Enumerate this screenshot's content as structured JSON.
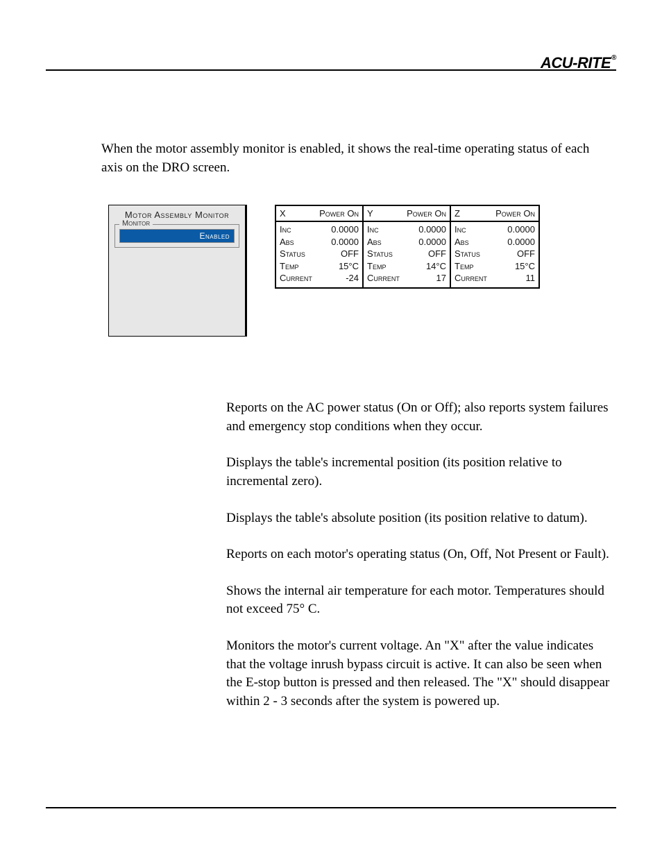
{
  "brand": "ACU-RITE",
  "brand_mark": "®",
  "intro": "When the motor assembly monitor is enabled, it shows the real-time operating status of each axis on the DRO screen.",
  "config": {
    "title": "Motor Assembly Monitor",
    "section_label": "Monitor",
    "state": "Enabled"
  },
  "dro": {
    "row_labels": {
      "inc": "Inc",
      "abs": "Abs",
      "status": "Status",
      "temp": "Temp",
      "current": "Current"
    },
    "power_label": "Power On",
    "axes": [
      {
        "axis": "X",
        "power": "Power On",
        "inc": "0.0000",
        "abs": "0.0000",
        "status": "OFF",
        "temp": "15°C",
        "current": "-24"
      },
      {
        "axis": "Y",
        "power": "Power On",
        "inc": "0.0000",
        "abs": "0.0000",
        "status": "OFF",
        "temp": "14°C",
        "current": "17"
      },
      {
        "axis": "Z",
        "power": "Power On",
        "inc": "0.0000",
        "abs": "0.0000",
        "status": "OFF",
        "temp": "15°C",
        "current": "11"
      }
    ]
  },
  "details": {
    "p1": "Reports on the AC power status (On or Off); also reports system failures and emergency stop conditions when they occur.",
    "p2": "Displays the table's incremental position (its position relative to incremental zero).",
    "p3": "Displays the table's absolute position (its position relative to datum).",
    "p4": "Reports on each motor's operating status (On, Off, Not Present or Fault).",
    "p5": "Shows the internal air temperature for each motor. Temperatures should not exceed 75° C.",
    "p6": "Monitors the motor's current voltage. An \"X\" after the value indicates that the voltage inrush bypass circuit is active. It can also be seen when the E-stop button is pressed and then released. The \"X\" should disappear within 2 - 3 seconds after the system is powered up."
  }
}
